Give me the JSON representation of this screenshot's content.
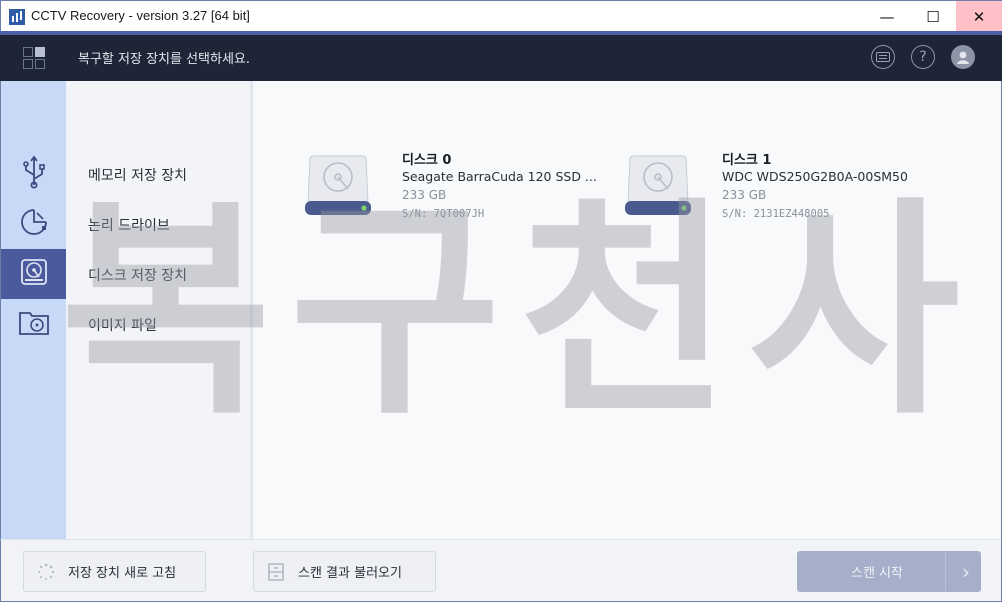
{
  "window": {
    "title": "CCTV Recovery - version 3.27 [64 bit]",
    "minimize_glyph": "—",
    "maximize_glyph": "☐",
    "close_glyph": "✕"
  },
  "header": {
    "title": "복구할 저장 장치를 선택하세요."
  },
  "sidebar": {
    "items": [
      {
        "label": "메모리 저장 장치",
        "icon": "usb-icon"
      },
      {
        "label": "논리 드라이브",
        "icon": "pie-drive-icon"
      },
      {
        "label": "디스크 저장 장치",
        "icon": "disk-drive-icon"
      },
      {
        "label": "이미지 파일",
        "icon": "image-file-icon"
      }
    ]
  },
  "disks": [
    {
      "name": "디스크 0",
      "model": "Seagate BarraCuda 120 SSD ...",
      "size": "233 GB",
      "serial": "S/N: 7QT007JH"
    },
    {
      "name": "디스크 1",
      "model": "WDC  WDS250G2B0A-00SM50",
      "size": "233 GB",
      "serial": "S/N: 2131EZ448005"
    }
  ],
  "watermark": [
    "복",
    "구",
    "천",
    "사"
  ],
  "footer": {
    "refresh_label": "저장 장치 새로 고침",
    "load_label": "스캔 결과 불러오기",
    "start_label": "스캔 시작"
  },
  "colors": {
    "header_bg": "#1e2536",
    "accent": "#4d5fa6",
    "rail_bg": "#c8d8f7",
    "rail_active": "#4a5a9c",
    "start_button": "#a5afca"
  }
}
